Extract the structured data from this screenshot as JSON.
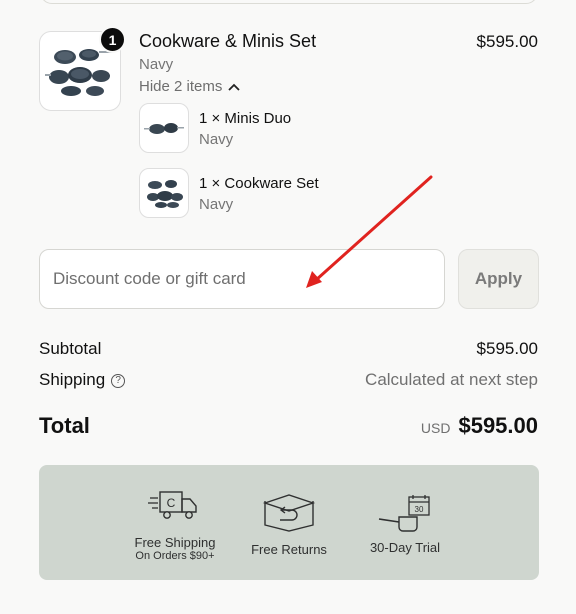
{
  "order_item": {
    "quantity": "1",
    "title": "Cookware & Minis Set",
    "variant": "Navy",
    "toggle_label": "Hide 2 items",
    "price": "$595.00",
    "components": [
      {
        "label": "1 × Minis Duo",
        "variant": "Navy"
      },
      {
        "label": "1 × Cookware Set",
        "variant": "Navy"
      }
    ]
  },
  "discount": {
    "placeholder": "Discount code or gift card",
    "apply_label": "Apply"
  },
  "summary": {
    "subtotal_label": "Subtotal",
    "subtotal_value": "$595.00",
    "shipping_label": "Shipping",
    "shipping_help_icon": "?",
    "shipping_value": "Calculated at next step",
    "total_label": "Total",
    "currency": "USD",
    "total_value": "$595.00"
  },
  "benefits": [
    {
      "icon": "delivery-truck-icon",
      "label": "Free Shipping",
      "sub": "On Orders $90+"
    },
    {
      "icon": "return-box-icon",
      "label": "Free Returns",
      "sub": ""
    },
    {
      "icon": "pan-calendar-icon",
      "label": "30-Day Trial",
      "sub": ""
    }
  ],
  "colors": {
    "annotation_arrow": "#e0231f",
    "benefits_background": "#cfd6cf"
  }
}
